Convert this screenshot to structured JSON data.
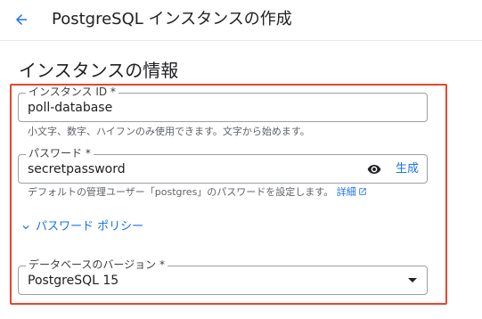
{
  "header": {
    "back_icon": "arrow-back-icon",
    "title": "PostgreSQL インスタンスの作成"
  },
  "section": {
    "title": "インスタンスの情報"
  },
  "instance_id": {
    "label": "インスタンス ID *",
    "value": "poll-database",
    "hint": "小文字、数字、ハイフンのみ使用できます。文字から始めます。"
  },
  "password": {
    "label": "パスワード *",
    "value": "secretpassword",
    "visibility_icon": "eye-icon",
    "generate_label": "生成",
    "hint": "デフォルトの管理ユーザー「postgres」のパスワードを設定します。",
    "details_link": "詳細",
    "details_icon": "open-in-new-icon"
  },
  "password_policy": {
    "icon": "chevron-down-icon",
    "label": "パスワード ポリシー"
  },
  "database_version": {
    "label": "データベースのバージョン *",
    "value": "PostgreSQL 15",
    "dropdown_icon": "dropdown-arrow-icon"
  },
  "colors": {
    "accent": "#1a73e8",
    "highlight_border": "#e8452c",
    "text": "#202124",
    "secondary_text": "#5f6368"
  }
}
